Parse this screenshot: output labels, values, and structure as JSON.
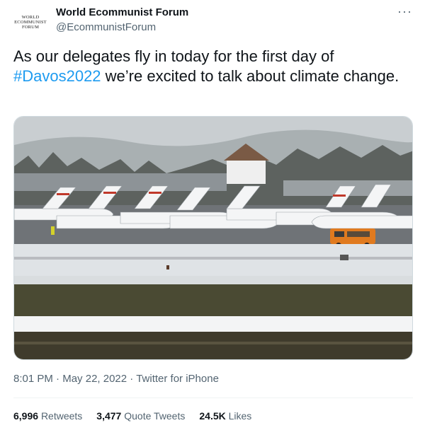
{
  "author": {
    "logo_lines": [
      "WORLD",
      "ECOMMUNIST",
      "FORUM"
    ],
    "name": "World Ecommunist Forum",
    "handle": "@EcommunistForum"
  },
  "more_label": "···",
  "tweet": {
    "text_before": "As our delegates fly in today for the first day of ",
    "hashtag": "#Davos2022",
    "text_after": " we’re excited to talk about climate change."
  },
  "media": {
    "icon": "airfield-photo",
    "description_colors": {
      "sky": "#c9ced1",
      "snow": "#e9ecee",
      "field": "#4a4a33",
      "van": "#e07a1f"
    }
  },
  "meta": {
    "time": "8:01 PM",
    "separator": "·",
    "date": "May 22, 2022",
    "source": "Twitter for iPhone"
  },
  "stats": {
    "retweets_count": "6,996",
    "retweets_label": "Retweets",
    "quotes_count": "3,477",
    "quotes_label": "Quote Tweets",
    "likes_count": "24.5K",
    "likes_label": "Likes"
  }
}
